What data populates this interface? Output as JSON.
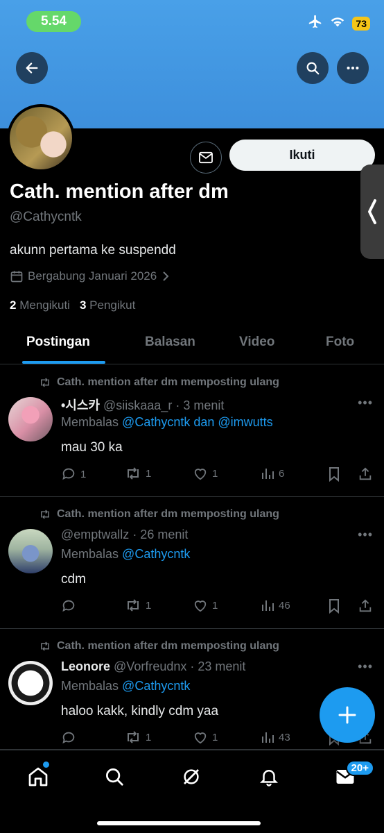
{
  "status_bar": {
    "time": "5.54",
    "battery": "73"
  },
  "profile": {
    "follow_label": "Ikuti",
    "name": "Cath. mention after dm",
    "handle": "@Cathycntk",
    "bio": "akunn pertama ke suspendd",
    "joined": "Bergabung Januari 2026",
    "following_count": "2",
    "following_label": "Mengikuti",
    "followers_count": "3",
    "followers_label": "Pengikut"
  },
  "tabs": [
    "Postingan",
    "Balasan",
    "Video",
    "Foto"
  ],
  "posts": [
    {
      "repost_text": "Cath. mention after dm memposting ulang",
      "author": "•시스카",
      "handle": "@siiskaaa_r",
      "time": "· 3 menit",
      "reply_prefix": "Membalas",
      "reply_to": "@Cathycntk dan @imwutts",
      "text": "mau 30 ka",
      "replies": "1",
      "reposts": "1",
      "likes": "1",
      "views": "6"
    },
    {
      "repost_text": "Cath. mention after dm memposting ulang",
      "author": "",
      "handle": "@emptwallz",
      "time": "· 26 menit",
      "reply_prefix": "Membalas",
      "reply_to": "@Cathycntk",
      "text": "cdm",
      "replies": "",
      "reposts": "1",
      "likes": "1",
      "views": "46"
    },
    {
      "repost_text": "Cath. mention after dm memposting ulang",
      "author": "Leonore",
      "handle": "@Vorfreudnx",
      "time": "· 23 menit",
      "reply_prefix": "Membalas",
      "reply_to": "@Cathycntk",
      "text": "haloo kakk, kindly cdm yaa",
      "replies": "",
      "reposts": "1",
      "likes": "1",
      "views": "43"
    }
  ],
  "nav": {
    "notifications_badge": "20+"
  },
  "colors": {
    "accent": "#1d9bf0",
    "banner": "#49a0e8",
    "background": "#000000",
    "muted": "#71767b"
  }
}
